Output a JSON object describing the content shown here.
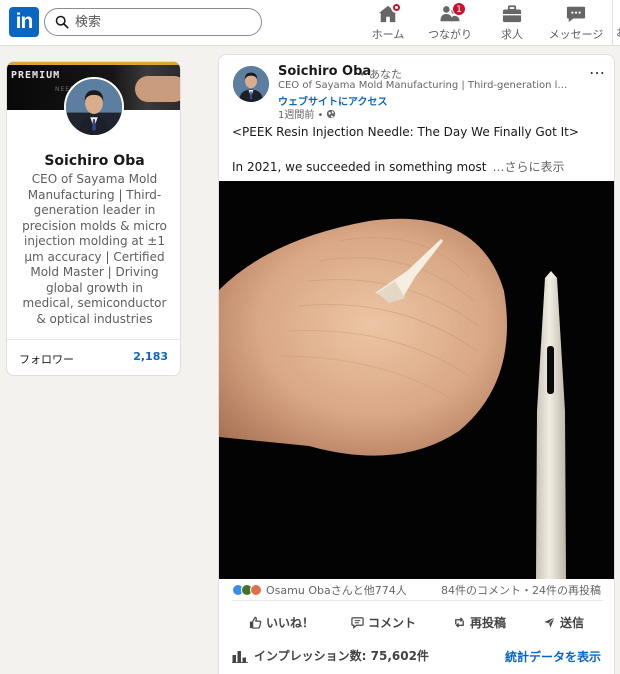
{
  "nav": {
    "logo": "in",
    "search_placeholder": "検索",
    "items": [
      {
        "label": "ホーム",
        "icon": "home-icon"
      },
      {
        "label": "つながり",
        "icon": "network-icon",
        "badge": "1"
      },
      {
        "label": "求人",
        "icon": "jobs-icon"
      },
      {
        "label": "メッセージ",
        "icon": "messaging-icon"
      }
    ],
    "more": "お"
  },
  "profile": {
    "cover_label": "PREMIUM",
    "cover_faint": "NEEDL",
    "name": "Soichiro Oba",
    "headline": "CEO of Sayama Mold Manufacturing | Third-generation leader in precision molds & micro injection molding at ±1 μm accuracy | Certified Mold Master | Driving global growth in medical, semiconductor & optical industries",
    "followers_label": "フォロワー",
    "followers_count": "2,183"
  },
  "post": {
    "author": "Soichiro Oba",
    "you_label": "• あなた",
    "author_headline": "CEO of Sayama Mold Manufacturing | Third-generation leader in precision molds & micro injection molding",
    "website_link": "ウェブサイトにアクセス",
    "time": "1週間前 •",
    "more_icon": "…",
    "title": "<PEEK Resin Injection Needle: The Day We Finally Got It>",
    "body": "In 2021, we succeeded in something most",
    "see_more": "…さらに表示",
    "reactions_text": "Osamu Obaさんと他774人",
    "comments_shares": "84件のコメント・24件の再投稿",
    "actions": [
      {
        "label": "いいね！",
        "icon": "like-icon"
      },
      {
        "label": "コメント",
        "icon": "comment-icon"
      },
      {
        "label": "再投稿",
        "icon": "repost-icon"
      },
      {
        "label": "送信",
        "icon": "send-icon"
      }
    ],
    "impressions": "インプレッション数: 75,602件",
    "stats_link": "統計データを表示"
  },
  "colors": {
    "brand": "#0a66c2",
    "badge": "#cb112d",
    "background": "#f4f2ee"
  }
}
